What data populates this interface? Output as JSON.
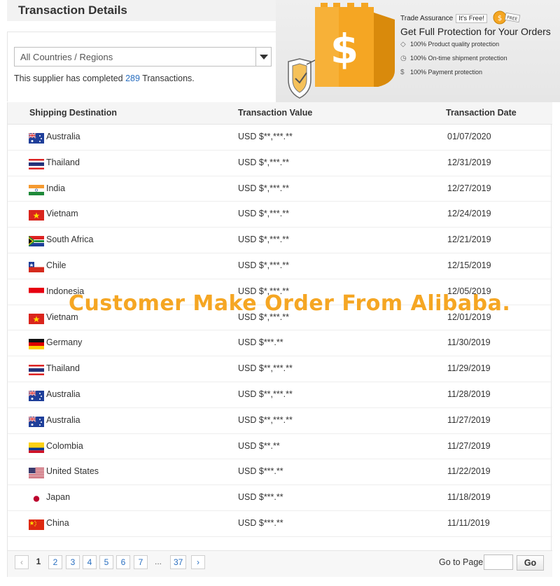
{
  "page": {
    "title": "Transaction Details"
  },
  "filter": {
    "region_value": "All Countries / Regions",
    "completed_prefix": "This supplier has completed ",
    "completed_count": "289",
    "completed_suffix": " Transactions."
  },
  "banner": {
    "label": "Trade Assurance",
    "free_badge": "It's Free!",
    "ribbon": "FREE",
    "headline": "Get Full Protection for Your Orders",
    "features": [
      {
        "icon": "diamond-icon",
        "text": "100% Product quality protection"
      },
      {
        "icon": "clock-icon",
        "text": "100% On-time shipment protection"
      },
      {
        "icon": "dollar-icon",
        "text": "100% Payment protection"
      }
    ],
    "colors": {
      "shield": "#f5a623",
      "shield_dark": "#e08e0b",
      "bg": "#ececec"
    }
  },
  "table": {
    "headers": [
      "Shipping Destination",
      "Transaction Value",
      "Transaction Date"
    ],
    "rows": [
      {
        "flag": "australia",
        "country": "Australia",
        "value": "USD $**,***.**",
        "date": "01/07/2020"
      },
      {
        "flag": "thailand",
        "country": "Thailand",
        "value": "USD $*,***.**",
        "date": "12/31/2019"
      },
      {
        "flag": "india",
        "country": "India",
        "value": "USD $*,***.**",
        "date": "12/27/2019"
      },
      {
        "flag": "vietnam",
        "country": "Vietnam",
        "value": "USD $*,***.**",
        "date": "12/24/2019"
      },
      {
        "flag": "south-africa",
        "country": "South Africa",
        "value": "USD $*,***.**",
        "date": "12/21/2019"
      },
      {
        "flag": "chile",
        "country": "Chile",
        "value": "USD $*,***.**",
        "date": "12/15/2019"
      },
      {
        "flag": "indonesia",
        "country": "Indonesia",
        "value": "USD $*,***.**",
        "date": "12/05/2019"
      },
      {
        "flag": "vietnam",
        "country": "Vietnam",
        "value": "USD $*,***.**",
        "date": "12/01/2019"
      },
      {
        "flag": "germany",
        "country": "Germany",
        "value": "USD $***.**",
        "date": "11/30/2019"
      },
      {
        "flag": "thailand",
        "country": "Thailand",
        "value": "USD $**,***.**",
        "date": "11/29/2019"
      },
      {
        "flag": "australia",
        "country": "Australia",
        "value": "USD $**,***.**",
        "date": "11/28/2019"
      },
      {
        "flag": "australia",
        "country": "Australia",
        "value": "USD $**,***.**",
        "date": "11/27/2019"
      },
      {
        "flag": "colombia",
        "country": "Colombia",
        "value": "USD $**.**",
        "date": "11/27/2019"
      },
      {
        "flag": "united-states",
        "country": "United States",
        "value": "USD $***.**",
        "date": "11/22/2019"
      },
      {
        "flag": "japan",
        "country": "Japan",
        "value": "USD $***.**",
        "date": "11/18/2019"
      },
      {
        "flag": "china",
        "country": "China",
        "value": "USD $***.**",
        "date": "11/11/2019"
      }
    ]
  },
  "pagination": {
    "prev": "‹",
    "pages": [
      "1",
      "2",
      "3",
      "4",
      "5",
      "6",
      "7"
    ],
    "current": "1",
    "ellipsis": "...",
    "last": "37",
    "next": "›",
    "goto_label": "Go to Page",
    "goto_value": "",
    "go_button": "Go"
  },
  "overlay": {
    "text": "Customer Make Order From Alibaba.",
    "color": "#f5a623"
  }
}
